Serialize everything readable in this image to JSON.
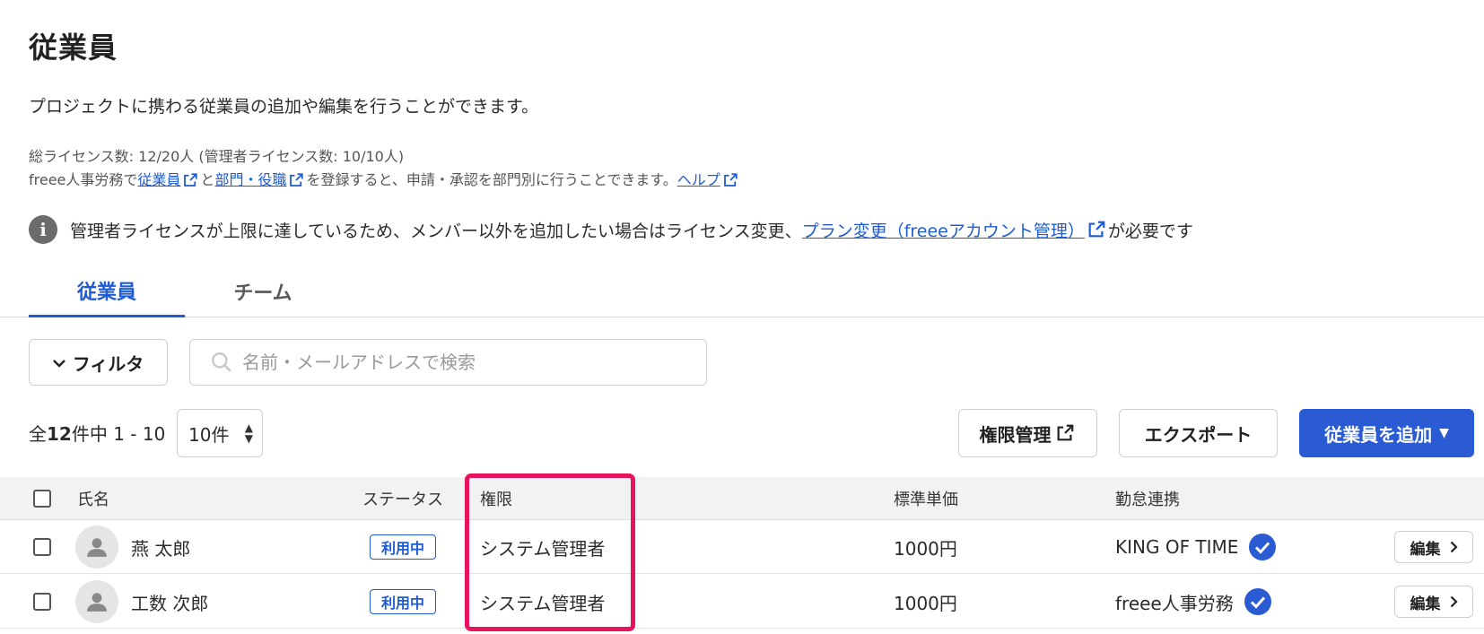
{
  "page": {
    "title": "従業員",
    "description": "プロジェクトに携わる従業員の追加や編集を行うことができます。",
    "license_line": "総ライセンス数: 12/20人 (管理者ライセンス数: 10/10人)",
    "info": {
      "prefix": "freee人事労務で",
      "link_employees": "従業員",
      "and": "と",
      "link_departments": "部門・役職",
      "middle": "を登録すると、申請・承認を部門別に行うことできます。",
      "link_help": "ヘルプ"
    },
    "notice": {
      "text": "管理者ライセンスが上限に達しているため、メンバー以外を追加したい場合はライセンス変更、",
      "link": "プラン変更（freeeアカウント管理）",
      "suffix": "が必要です"
    }
  },
  "tabs": [
    {
      "label": "従業員",
      "active": true
    },
    {
      "label": "チーム",
      "active": false
    }
  ],
  "toolbar": {
    "filter_label": "フィルタ",
    "search_placeholder": "名前・メールアドレスで検索"
  },
  "pagination": {
    "prefix": "全",
    "total": "12",
    "range": "件中 1 - 10",
    "per_page": "10件"
  },
  "actions": {
    "permission_label": "権限管理",
    "export_label": "エクスポート",
    "add_label": "従業員を追加"
  },
  "table": {
    "headers": {
      "name": "氏名",
      "status": "ステータス",
      "role": "権限",
      "rate": "標準単価",
      "attendance": "勤怠連携"
    },
    "rows": [
      {
        "name": "燕 太郎",
        "status": "利用中",
        "role": "システム管理者",
        "rate": "1000円",
        "attendance": "KING OF TIME",
        "edit": "編集"
      },
      {
        "name": "工数 次郎",
        "status": "利用中",
        "role": "システム管理者",
        "rate": "1000円",
        "attendance": "freee人事労務",
        "edit": "編集"
      }
    ]
  },
  "colors": {
    "accent": "#1f5bd1",
    "primary_button": "#2a5bd3",
    "highlight": "#e8135f"
  },
  "icons": [
    "info-icon",
    "external-link-icon",
    "search-icon",
    "chevron-down-icon",
    "user-icon",
    "check-circle-icon",
    "chevron-right-icon"
  ]
}
